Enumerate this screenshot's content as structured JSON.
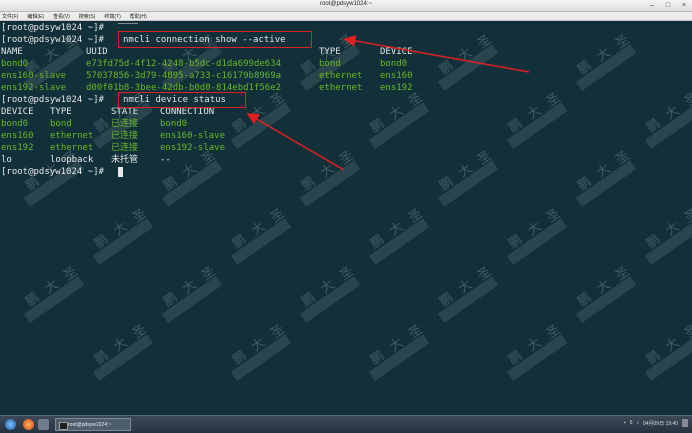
{
  "window": {
    "title": "root@pdsyw1024:~"
  },
  "menu": [
    "文件(F)",
    "编辑(E)",
    "查看(V)",
    "搜索(S)",
    "终端(T)",
    "帮助(H)"
  ],
  "terminal": {
    "l0": "[root@pdsyw1024 ~]#",
    "l1_prompt": "[root@pdsyw1024 ~]#",
    "l1_cmd": "nmcli connection show --active",
    "conn_header": [
      "NAME",
      "UUID",
      "TYPE",
      "DEVICE"
    ],
    "conn_rows": [
      [
        "bond0",
        "e73fd75d-4f12-4248-b5dc-d1da699de634",
        "bond",
        "bond0"
      ],
      [
        "ens160-slave",
        "57037856-3d79-4895-a733-c16179b8969a",
        "ethernet",
        "ens160"
      ],
      [
        "ens192-slave",
        "d00f01b8-3bee-42db-b0d0-814ebd1f56e2",
        "ethernet",
        "ens192"
      ]
    ],
    "l5_prompt": "[root@pdsyw1024 ~]#",
    "l5_cmd": "nmcli device status",
    "dev_header": [
      "DEVICE",
      "TYPE",
      "STATE",
      "CONNECTION"
    ],
    "dev_rows": [
      [
        "bond0",
        "bond",
        "已连接",
        "bond0"
      ],
      [
        "ens160",
        "ethernet",
        "已连接",
        "ens160-slave"
      ],
      [
        "ens192",
        "ethernet",
        "已连接",
        "ens192-slave"
      ],
      [
        "lo",
        "loopback",
        "未托管",
        "--"
      ]
    ],
    "l11": "[root@pdsyw1024 ~]#"
  },
  "watermark": [
    "鹏",
    "大",
    "圣"
  ],
  "taskbar": {
    "task_label": "root@pdsyw1024:~",
    "tray_num": "6",
    "tray_time": "04月09日 19:40"
  }
}
